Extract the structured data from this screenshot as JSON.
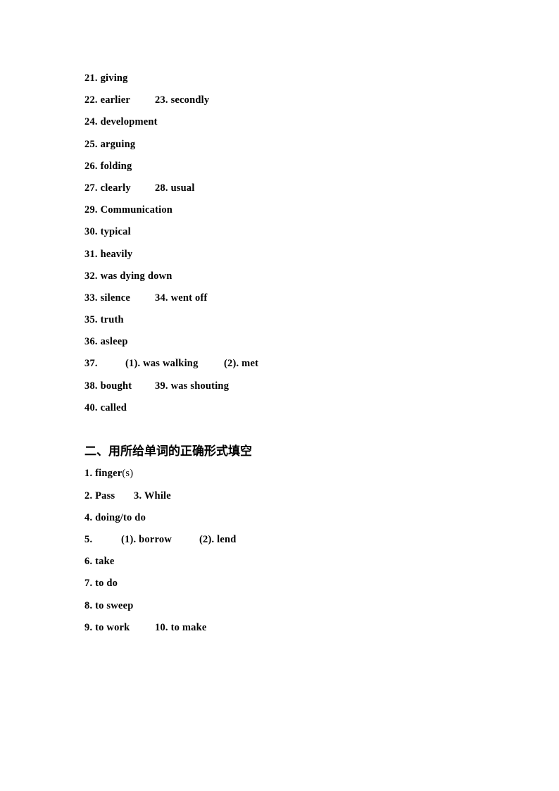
{
  "document": {
    "page_background": "#ffffff",
    "text_color": "#000000"
  },
  "section_one": {
    "lines": [
      {
        "a_num": "21.",
        "a_val": "giving",
        "b_num": "",
        "b_val": ""
      },
      {
        "a_num": "22.",
        "a_val": "earlier",
        "b_num": "23.",
        "b_val": "secondly"
      },
      {
        "a_num": "24.",
        "a_val": "development",
        "b_num": "",
        "b_val": ""
      },
      {
        "a_num": "25.",
        "a_val": "arguing",
        "b_num": "",
        "b_val": ""
      },
      {
        "a_num": "26.",
        "a_val": "folding",
        "b_num": "",
        "b_val": ""
      },
      {
        "a_num": "27.",
        "a_val": "clearly",
        "b_num": "28.",
        "b_val": "usual"
      },
      {
        "a_num": "29.",
        "a_val": "Communication",
        "b_num": "",
        "b_val": ""
      },
      {
        "a_num": "30.",
        "a_val": "typical",
        "b_num": "",
        "b_val": ""
      },
      {
        "a_num": "31.",
        "a_val": "heavily",
        "b_num": "",
        "b_val": ""
      },
      {
        "a_num": "32.",
        "a_val": "was dying down",
        "b_num": "",
        "b_val": ""
      },
      {
        "a_num": "33.",
        "a_val": "silence",
        "b_num": "34.",
        "b_val": "went off"
      },
      {
        "a_num": "35.",
        "a_val": "truth",
        "b_num": "",
        "b_val": ""
      },
      {
        "a_num": "36.",
        "a_val": "asleep",
        "b_num": "",
        "b_val": ""
      }
    ],
    "line_37": {
      "num": "37.",
      "sub1_num": "(1).",
      "sub1_val": "was walking",
      "sub2_num": "(2).",
      "sub2_val": "met"
    },
    "line_38_39": {
      "a_num": "38.",
      "a_val": "bought",
      "b_num": "39.",
      "b_val": "was shouting"
    },
    "line_40": {
      "num": "40.",
      "val": "called"
    }
  },
  "section_two": {
    "heading": "二、用所给单词的正确形式填空",
    "line_1": {
      "num": "1.",
      "val": "finger",
      "suffix": "(s)"
    },
    "line_2_3": {
      "a_num": "2.",
      "a_val": "Pass",
      "b_num": "3.",
      "b_val": "While"
    },
    "line_4": {
      "num": "4.",
      "val": "doing/to do"
    },
    "line_5": {
      "num": "5.",
      "sub1_num": "(1).",
      "sub1_val": "borrow",
      "sub2_num": "(2).",
      "sub2_val": "lend"
    },
    "line_6": {
      "num": "6.",
      "val": "take"
    },
    "line_7": {
      "num": "7.",
      "val": "to do"
    },
    "line_8": {
      "num": "8.",
      "val": "to sweep"
    },
    "line_9_10": {
      "a_num": "9.",
      "a_val": "to work",
      "b_num": "10.",
      "b_val": "to make"
    }
  }
}
